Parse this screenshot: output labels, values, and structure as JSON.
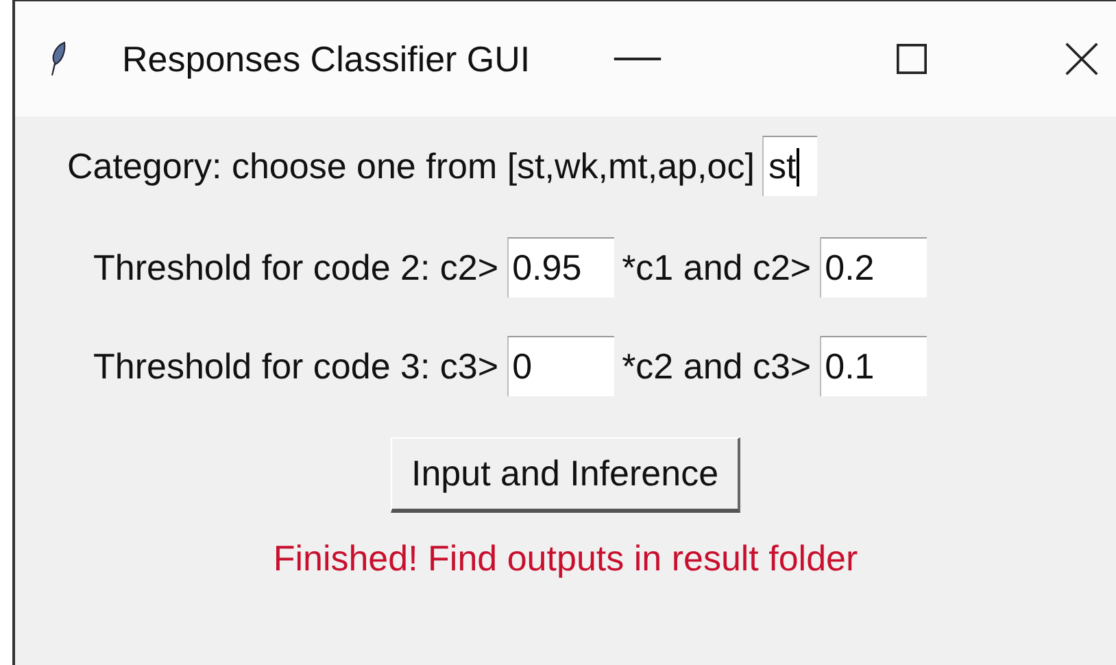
{
  "window": {
    "title": "Responses Classifier GUI"
  },
  "category": {
    "label": "Category: choose one from [st,wk,mt,ap,oc]",
    "value": "st",
    "focused": true
  },
  "thresholds": [
    {
      "label": "Threshold for code 2: c2>",
      "value": "0.95",
      "label_2": "*c1 and c2>",
      "value_2": "0.2"
    },
    {
      "label": "Threshold for code 3: c3>",
      "value": "0",
      "label_2": "*c2 and c3>",
      "value_2": "0.1"
    }
  ],
  "button": {
    "label": "Input and Inference"
  },
  "status": {
    "text": "Finished! Find outputs in result folder"
  }
}
